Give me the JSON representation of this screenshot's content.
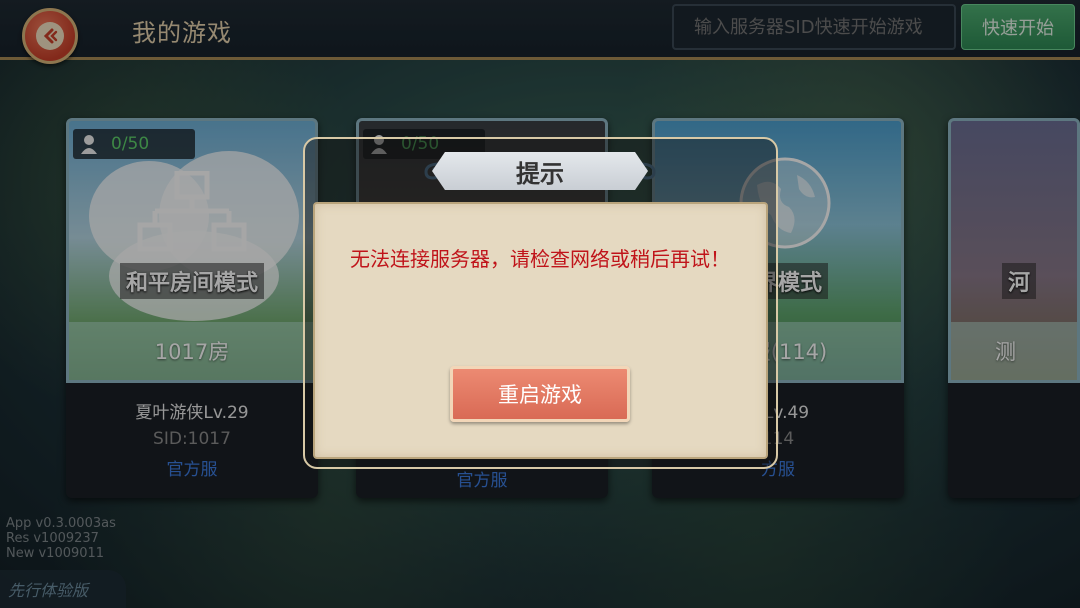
{
  "header": {
    "title": "我的游戏",
    "sid_placeholder": "输入服务器SID快速开始游戏",
    "quick_start_label": "快速开始"
  },
  "cards": [
    {
      "player_count": "0/50",
      "mode": "和平房间模式",
      "room": "1017房",
      "host": "夏叶游侠Lv.29",
      "sid": "SID:1017",
      "server_type": "官方服"
    },
    {
      "player_count": "0/50",
      "mode": "",
      "room": "",
      "host": "",
      "sid": "",
      "server_type": "官方服"
    },
    {
      "player_count": "",
      "mode": "世界模式",
      "room": "平服(114)",
      "host": "丹Lv.49",
      "sid": "114",
      "server_type": "方服"
    },
    {
      "player_count": "",
      "mode": "河",
      "room": "测",
      "host": "",
      "sid": "",
      "server_type": ""
    }
  ],
  "version": {
    "app": "App  v0.3.0003as",
    "res": "Res   v1009237",
    "new": "New  v1009011"
  },
  "preview_tag": "先行体验版",
  "dialog": {
    "title": "提示",
    "message": "无法连接服务器，请检查网络或稍后再试！",
    "restart_label": "重启游戏"
  },
  "colors": {
    "message_red": "#c0141a",
    "player_count_green": "#5ed06a",
    "server_type_blue": "#3d7ce0",
    "restart_button": "#d96a55",
    "quick_start_green": "#2f8a55"
  }
}
